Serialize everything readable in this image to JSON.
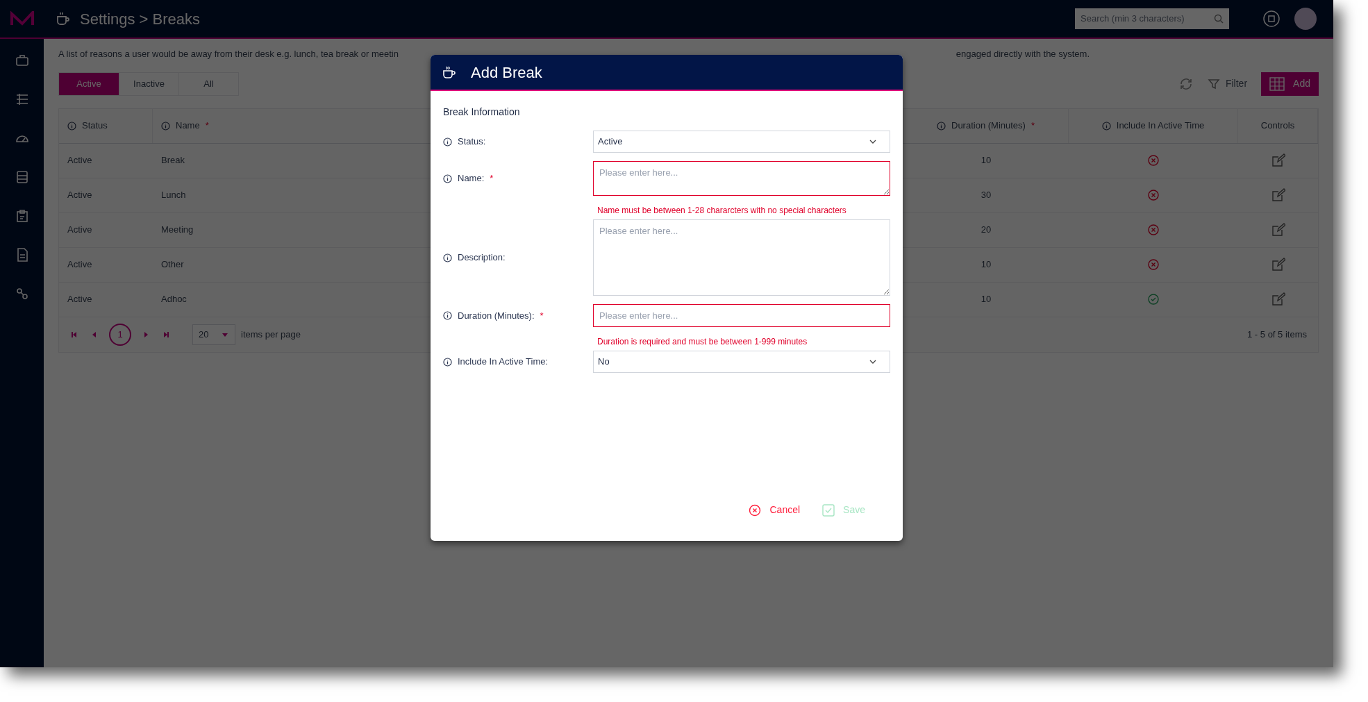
{
  "app": {
    "breadcrumb": "Settings > Breaks",
    "search": {
      "placeholder": "Search (min 3 characters)"
    }
  },
  "page": {
    "description_start": "A list of reasons a user would be away from their desk e.g. lunch, tea break or meetin",
    "description_end": "engaged directly with the system."
  },
  "tabs": [
    {
      "label": "Active",
      "selected": true
    },
    {
      "label": "Inactive",
      "selected": false
    },
    {
      "label": "All",
      "selected": false
    }
  ],
  "toolbar": {
    "filter": "Filter",
    "add": "Add"
  },
  "table": {
    "columns": [
      {
        "label": "Status",
        "info": true
      },
      {
        "label": "Name",
        "info": true,
        "required_mark": "*"
      },
      {
        "label": "Duration (Minutes)",
        "info": true,
        "required_mark": "*"
      },
      {
        "label": "Include In Active Time",
        "info": true
      },
      {
        "label": "Controls",
        "info": false
      }
    ],
    "rows": [
      {
        "status": "Active",
        "name": "Break",
        "duration": "10",
        "included": false
      },
      {
        "status": "Active",
        "name": "Lunch",
        "duration": "30",
        "included": false
      },
      {
        "status": "Active",
        "name": "Meeting",
        "duration": "20",
        "included": false
      },
      {
        "status": "Active",
        "name": "Other",
        "duration": "10",
        "included": false
      },
      {
        "status": "Active",
        "name": "Adhoc",
        "duration": "10",
        "included": true
      }
    ]
  },
  "pagination": {
    "pages": [
      {
        "label": "1",
        "selected": true
      }
    ],
    "page_size": "20",
    "page_size_label": "items per page",
    "summary": "1 - 5 of 5 items"
  },
  "dialog": {
    "title": "Add Break",
    "section": "Break Information",
    "fields": [
      {
        "kind": "select",
        "label": "Status:",
        "value": "Active"
      },
      {
        "kind": "short_textarea",
        "label": "Name:",
        "required_mark": "*",
        "placeholder": "Please enter here...",
        "error": "Name must be between 1-28 chararcters with no special characters"
      },
      {
        "kind": "textarea",
        "label": "Description:",
        "placeholder": "Please enter here..."
      },
      {
        "kind": "input",
        "label": "Duration (Minutes):",
        "required_mark": "*",
        "placeholder": "Please enter here...",
        "error": "Duration is required and must be between 1-999 minutes"
      },
      {
        "kind": "select",
        "label": "Include In Active Time:",
        "value": "No"
      }
    ],
    "buttons": [
      {
        "kind": "cancel",
        "label": "Cancel",
        "disabled": false
      },
      {
        "kind": "save",
        "label": "Save",
        "disabled": true
      }
    ]
  }
}
